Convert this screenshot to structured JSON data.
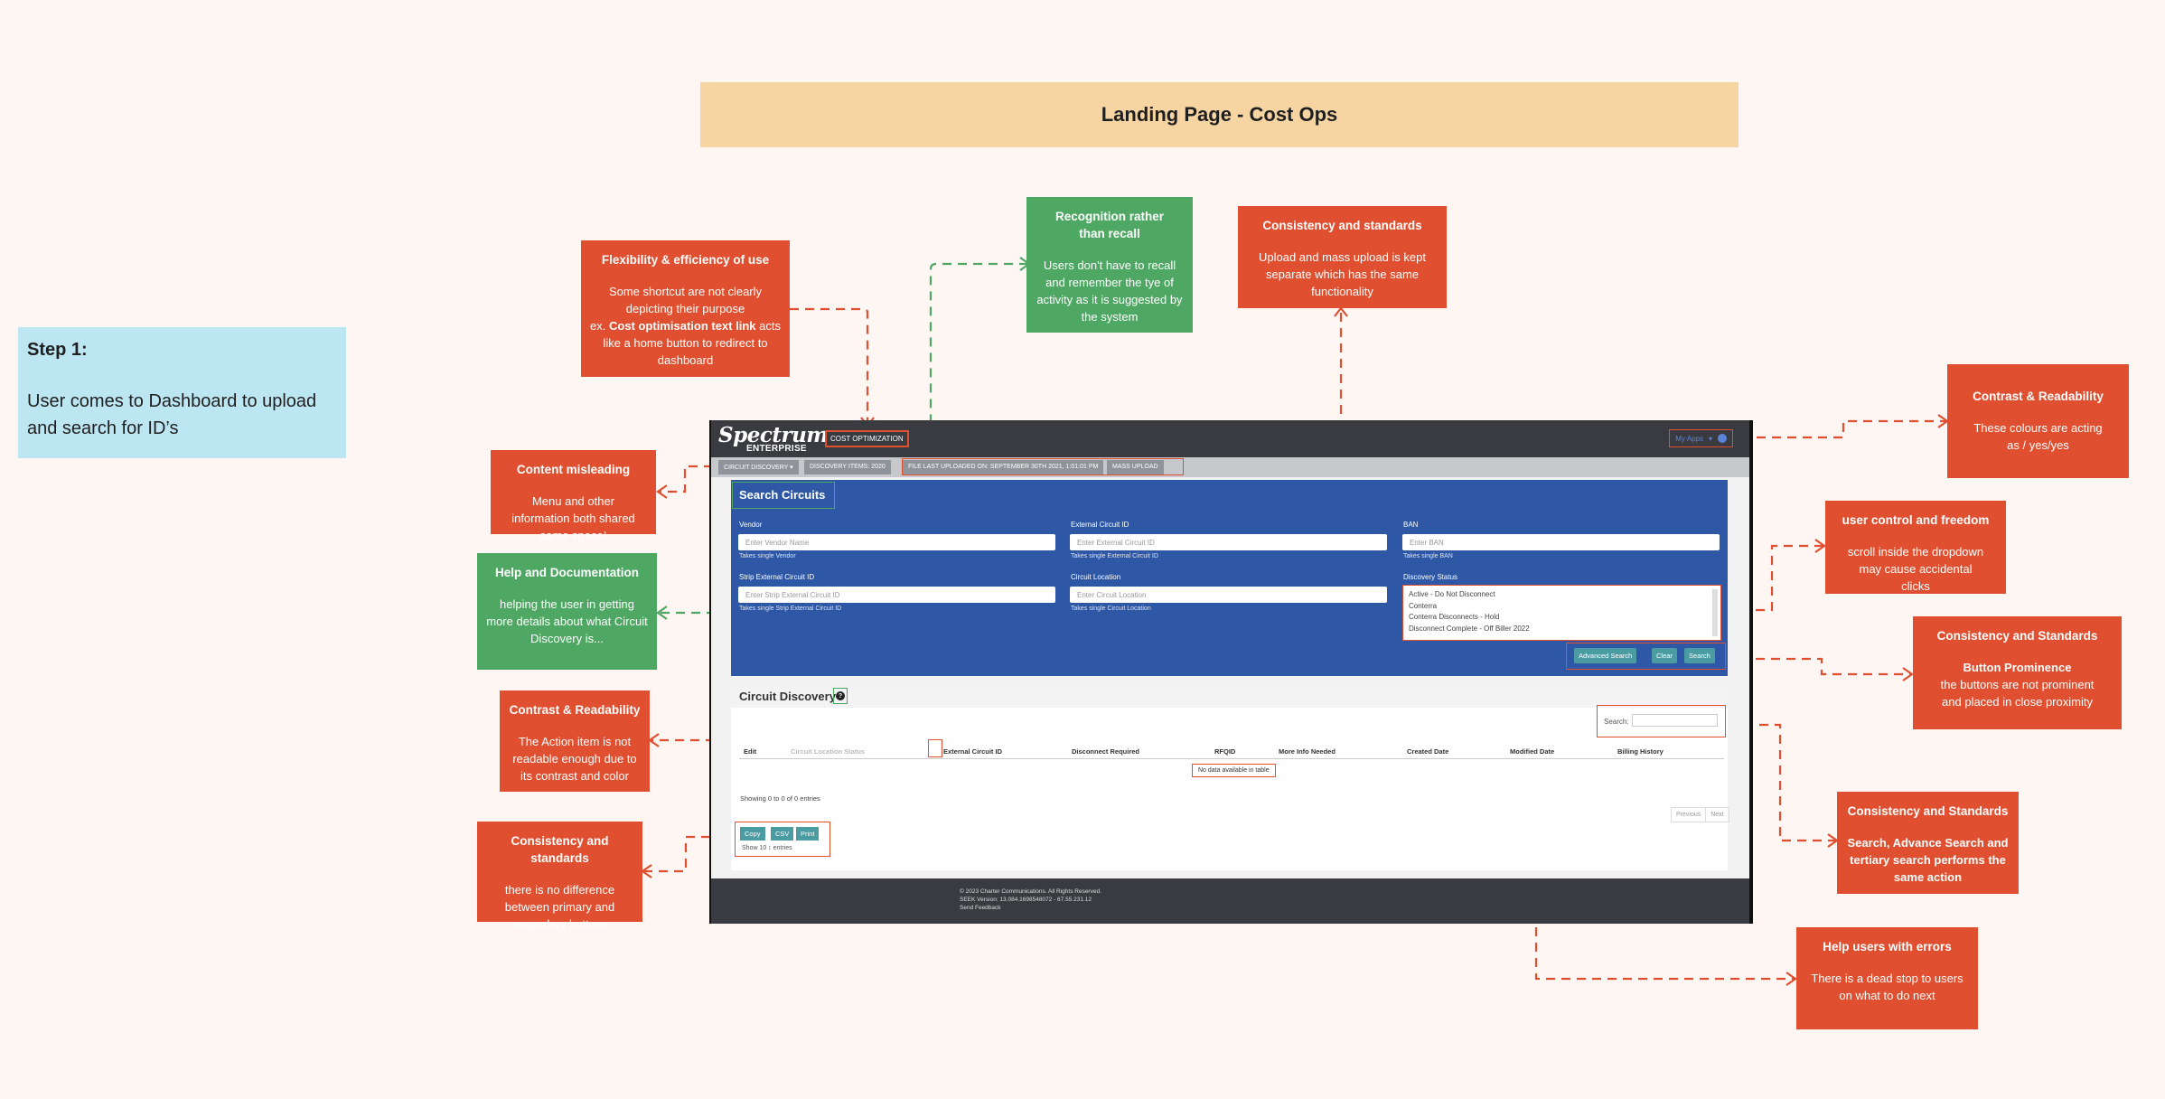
{
  "title": "Landing Page - Cost Ops",
  "step": {
    "heading": "Step 1:",
    "text": "User comes to Dashboard to upload and search for ID’s"
  },
  "notes": {
    "flexibility": {
      "title": "Flexibility & efficiency of use",
      "line1": "Some shortcut are not clearly depicting their purpose",
      "line2_prefix": "ex.",
      "line2_bold": "Cost optimisation text link",
      "line2_suffix": "acts like a home button to redirect to dashboard"
    },
    "recognition": {
      "title": "Recognition rather than recall",
      "body": "Users don't have to recall and remember the tye of activity as it is suggested by the system"
    },
    "consistency_upload": {
      "title": "Consistency and standards",
      "body": "Upload and mass upload is kept separate which has the same functionality"
    },
    "contrast_apps": {
      "title": "Contrast & Readability",
      "body": "These colours are acting as / yes/yes"
    },
    "content_misleading": {
      "title": "Content misleading",
      "body": "Menu and other information both shared same space!"
    },
    "help_docs": {
      "title": "Help and Documentation",
      "body": "helping the user in getting more details about what Circuit Discovery is..."
    },
    "user_control": {
      "title": "user control and freedom",
      "body": "scroll inside the dropdown may cause accidental clicks"
    },
    "consistency_buttons": {
      "title": "Consistency and Standards",
      "subtitle": "Button Prominence",
      "body": "the buttons are not prominent and placed in close proximity"
    },
    "contrast_action": {
      "title": "Contrast & Readability",
      "body": "The Action item is not readable enough due to its contrast and color"
    },
    "consistency_search": {
      "title": "Consistency and Standards",
      "body": "Search, Advance Search and tertiary search performs the same action"
    },
    "consistency_export": {
      "title": "Consistency and standards",
      "body": "there is no difference between primary and secondary buttons"
    },
    "errors": {
      "title": "Help users with errors",
      "body": "There is a dead stop to users on what to do next"
    }
  },
  "app": {
    "logo": "Spectrum",
    "logo_sub": "ENTERPRISE",
    "cost_optimization": "COST OPTIMIZATION",
    "my_apps": "My Apps",
    "tabs": [
      "CIRCUIT DISCOVERY ▾",
      "DISCOVERY ITEMS: 2020",
      "FILE LAST UPLOADED ON: SEPTEMBER 30TH 2021, 1:01:01 PM",
      "MASS UPLOAD"
    ],
    "search": {
      "title": "Search Circuits",
      "fields": [
        {
          "label": "Vendor",
          "placeholder": "Enter Vendor Name",
          "hint": "Takes single Vendor"
        },
        {
          "label": "External Circuit ID",
          "placeholder": "Enter External Circuit ID",
          "hint": "Takes single External Circuit ID"
        },
        {
          "label": "BAN",
          "placeholder": "Enter BAN",
          "hint": "Takes single BAN"
        },
        {
          "label": "Strip External Circuit ID",
          "placeholder": "Enter Strip External Circuit ID",
          "hint": "Takes single Strip External Circuit ID"
        },
        {
          "label": "Circuit Location",
          "placeholder": "Enter Circuit Location",
          "hint": "Takes single Circuit Location"
        }
      ],
      "status_label": "Discovery Status",
      "status_options": [
        "Active - Do Not Disconnect",
        "Conterra",
        "Conterra Disconnects - Hold",
        "Disconnect Complete - Off Biller 2022"
      ],
      "buttons": [
        "Advanced Search",
        "Clear",
        "Search"
      ]
    },
    "discovery": {
      "title": "Circuit Discovery",
      "help": "?",
      "search_label": "Search:",
      "columns": [
        "Edit",
        "Circuit Location Status",
        "External Circuit ID",
        "Disconnect Required",
        "RFQID",
        "More Info Needed",
        "Created Date",
        "Modified Date",
        "Billing History"
      ],
      "no_data": "No data available in table",
      "showing": "Showing 0 to 0 of 0 entries",
      "pager": [
        "Previous",
        "Next"
      ],
      "export_buttons": [
        "Copy",
        "CSV",
        "Print"
      ],
      "show_entries": "Show  10  ↕  entries"
    },
    "footer": [
      "© 2023 Charter Communications. All Rights Reserved.",
      "SEEK Version: 13.084.1698548072 - 67.55.231.12",
      "Send Feedback"
    ]
  },
  "colors": {
    "accent_red": "#e04f2f",
    "accent_green": "#4ea863",
    "title_bg": "#f6d5a3",
    "step_bg": "#bde6f3",
    "panel_blue": "#2e58a5"
  }
}
